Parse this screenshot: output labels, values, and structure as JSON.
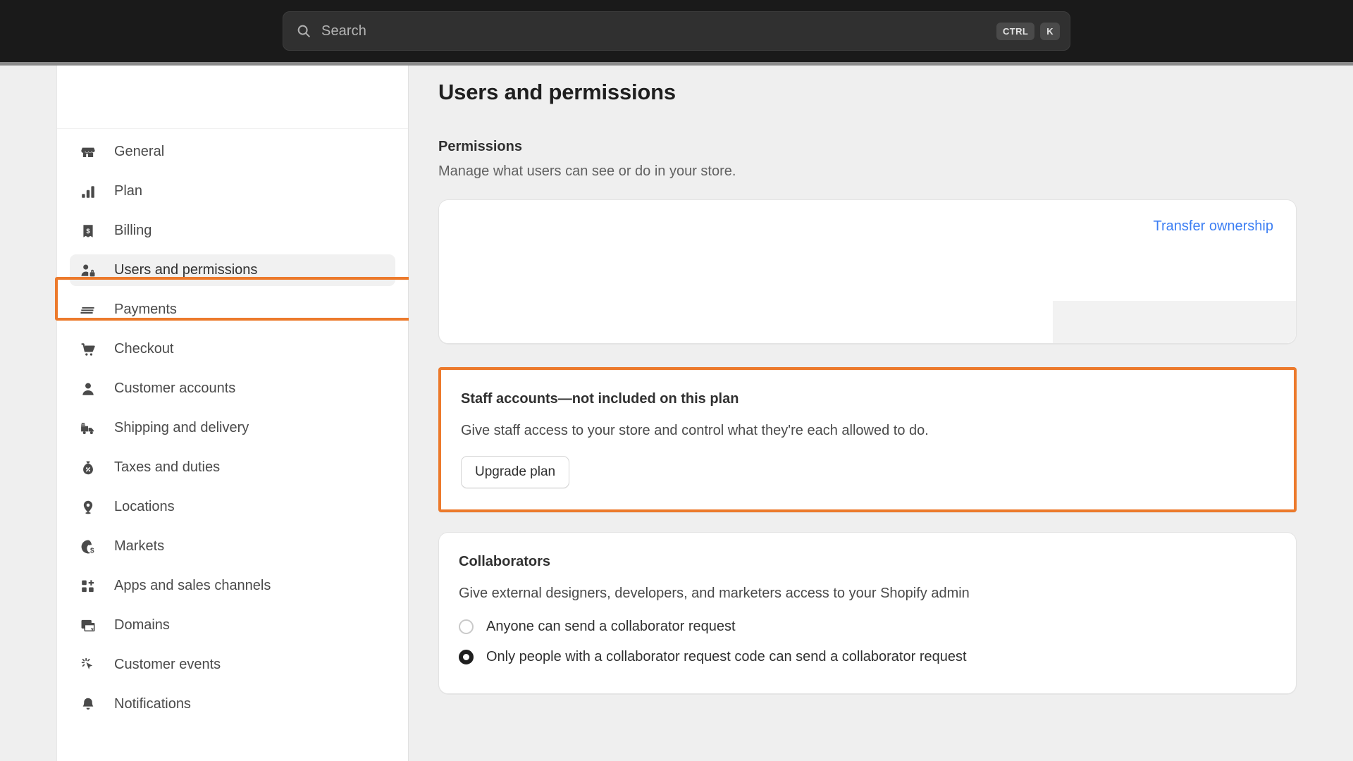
{
  "topbar": {
    "search": {
      "icon": "search-icon",
      "placeholder": "Search",
      "shortcut_keys": [
        "CTRL",
        "K"
      ]
    }
  },
  "sidebar": {
    "items": [
      {
        "label": "General",
        "icon": "store-icon",
        "selected": false
      },
      {
        "label": "Plan",
        "icon": "chart-bar-icon",
        "selected": false
      },
      {
        "label": "Billing",
        "icon": "receipt-dollar-icon",
        "selected": false
      },
      {
        "label": "Users and permissions",
        "icon": "users-lock-icon",
        "selected": true
      },
      {
        "label": "Payments",
        "icon": "credit-card-icon",
        "selected": false
      },
      {
        "label": "Checkout",
        "icon": "cart-icon",
        "selected": false
      },
      {
        "label": "Customer accounts",
        "icon": "person-icon",
        "selected": false
      },
      {
        "label": "Shipping and delivery",
        "icon": "delivery-truck-icon",
        "selected": false
      },
      {
        "label": "Taxes and duties",
        "icon": "money-bag-percent-icon",
        "selected": false
      },
      {
        "label": "Locations",
        "icon": "map-pin-icon",
        "selected": false
      },
      {
        "label": "Markets",
        "icon": "globe-dollar-icon",
        "selected": false
      },
      {
        "label": "Apps and sales channels",
        "icon": "apps-grid-plus-icon",
        "selected": false
      },
      {
        "label": "Domains",
        "icon": "domain-window-icon",
        "selected": false
      },
      {
        "label": "Customer events",
        "icon": "cursor-click-icon",
        "selected": false
      },
      {
        "label": "Notifications",
        "icon": "bell-icon",
        "selected": false
      }
    ]
  },
  "main": {
    "title": "Users and permissions",
    "permissions": {
      "heading": "Permissions",
      "description": "Manage what users can see or do in your store."
    },
    "owner_card": {
      "transfer_ownership_label": "Transfer ownership"
    },
    "staff_card": {
      "title": "Staff accounts—not included on this plan",
      "description": "Give staff access to your store and control what they're each allowed to do.",
      "button_label": "Upgrade plan"
    },
    "collaborators_card": {
      "title": "Collaborators",
      "description": "Give external designers, developers, and marketers access to your Shopify admin",
      "options": [
        {
          "label": "Anyone can send a collaborator request",
          "selected": false
        },
        {
          "label": "Only people with a collaborator request code can send a collaborator request",
          "selected": true
        }
      ]
    }
  },
  "annotations": {
    "highlight_color": "#ec7a2c",
    "targets": [
      "sidebar-item-users-and-permissions",
      "staff-accounts-card"
    ]
  }
}
